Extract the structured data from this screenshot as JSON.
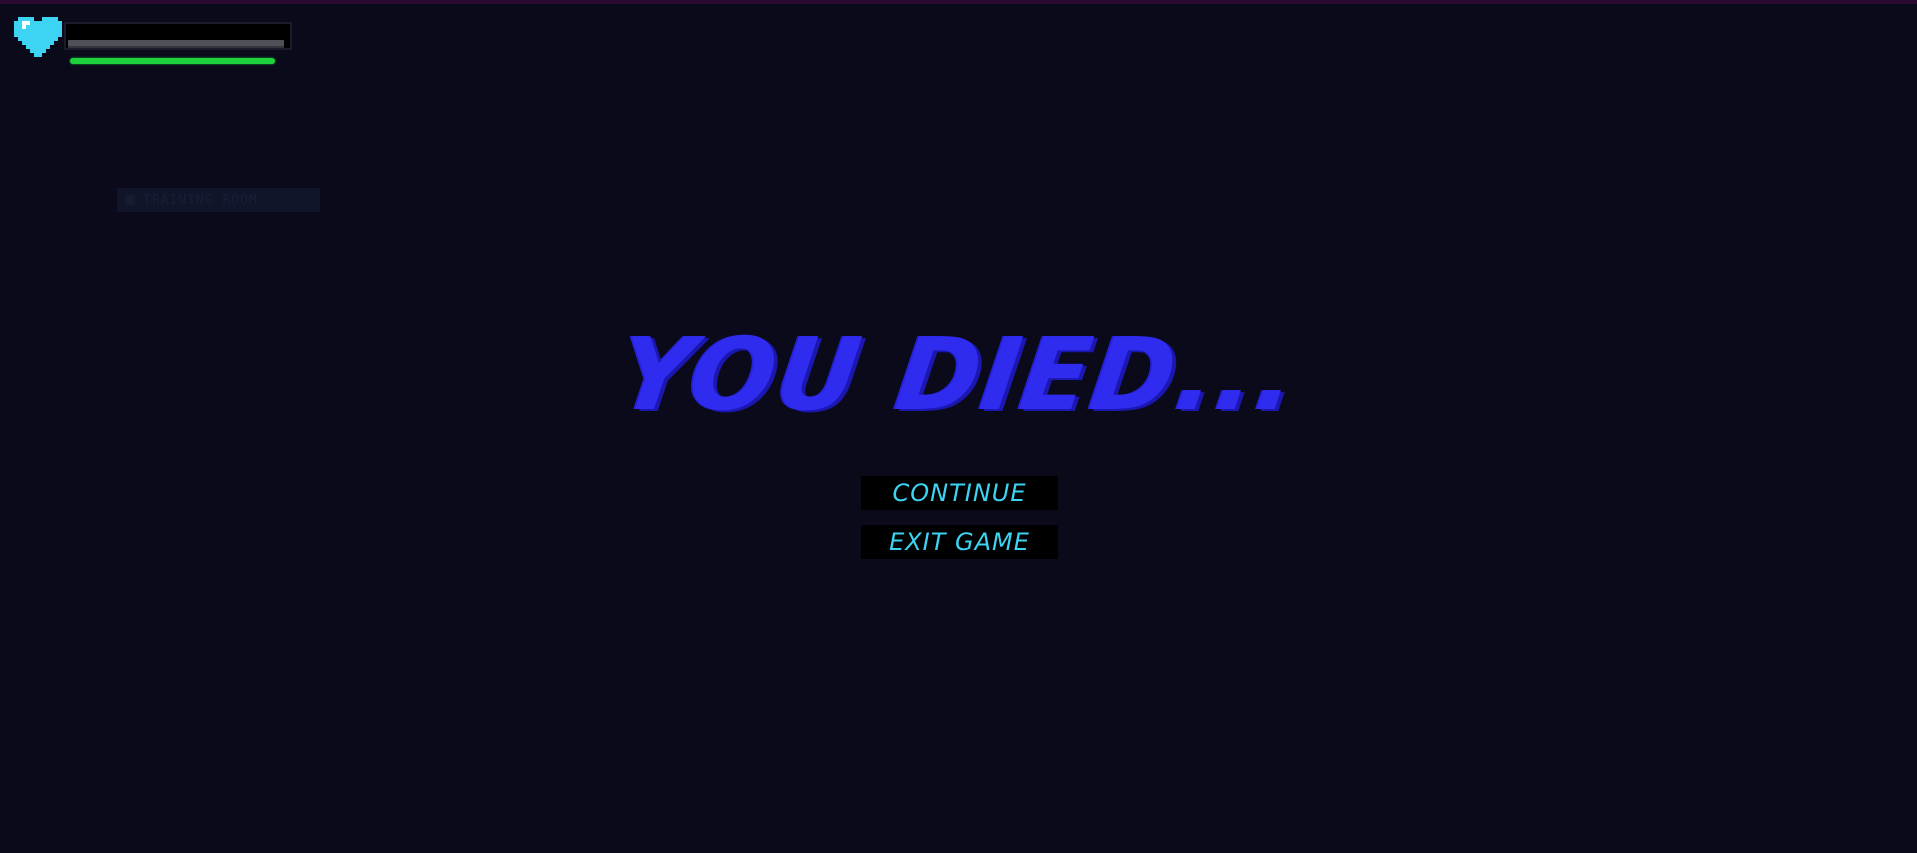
{
  "game": {
    "title": "YOU DIED...",
    "menu": {
      "continue_label": "CONTINUE",
      "exit_label": "EXIT GAME"
    }
  },
  "hud": {
    "health_fraction": 0.98,
    "stamina_fraction": 0.95,
    "heart_color": "#3cd4f2",
    "health_color": "#505058",
    "stamina_color": "#1ed13c"
  },
  "background_hint": {
    "label": "TRAINING ROOM"
  },
  "colors": {
    "background": "#0a0a1a",
    "title": "#2f2cf0",
    "button_text": "#3cd4f2",
    "button_bg": "#000000"
  }
}
